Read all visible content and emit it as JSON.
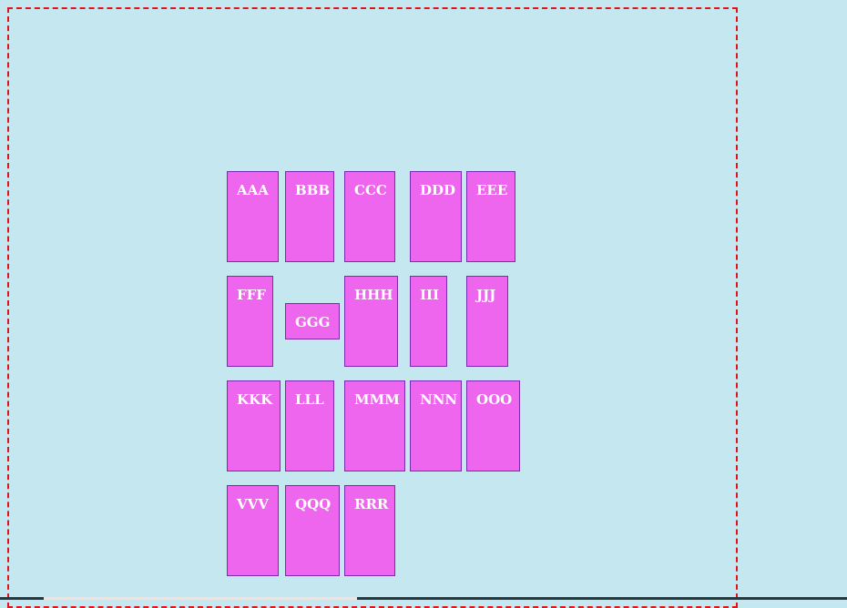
{
  "tiles": [
    {
      "label": "AAA"
    },
    {
      "label": "BBB"
    },
    {
      "label": "CCC"
    },
    {
      "label": "DDD"
    },
    {
      "label": "EEE"
    },
    {
      "label": "FFF"
    },
    {
      "label": "GGG"
    },
    {
      "label": "HHH"
    },
    {
      "label": "III"
    },
    {
      "label": "JJJ"
    },
    {
      "label": "KKK"
    },
    {
      "label": "LLL"
    },
    {
      "label": "MMM"
    },
    {
      "label": "NNN"
    },
    {
      "label": "OOO"
    },
    {
      "label": "VVV"
    },
    {
      "label": "QQQ"
    },
    {
      "label": "RRR"
    }
  ],
  "colors": {
    "background": "#c5e7ef",
    "tile_fill": "#ef66ee",
    "tile_border": "#7a2bb0",
    "frame_border": "#e0121a",
    "tile_text": "#ffffff"
  }
}
